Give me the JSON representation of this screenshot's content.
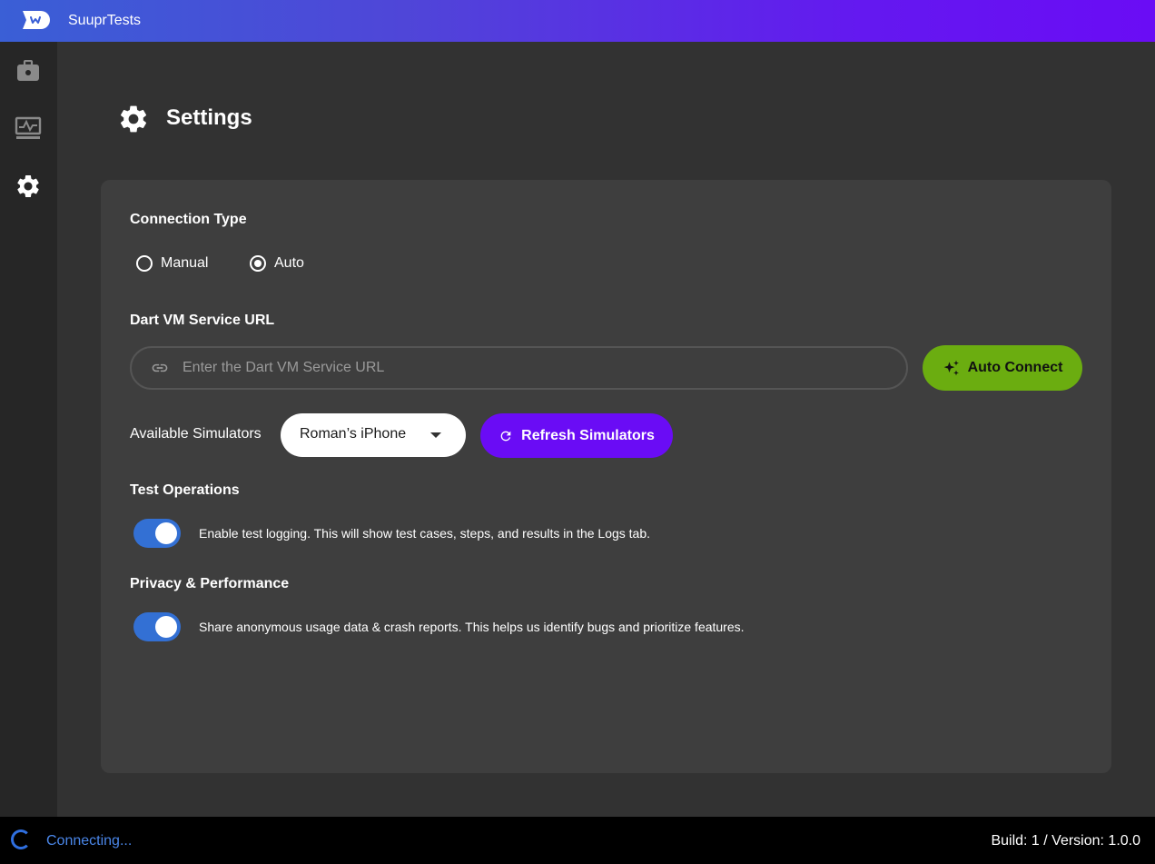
{
  "app": {
    "title": "SuuprTests"
  },
  "sidebar": {
    "items": [
      {
        "icon": "briefcase-icon",
        "active": false
      },
      {
        "icon": "monitor-activity-icon",
        "active": false
      },
      {
        "icon": "gear-icon",
        "active": true
      }
    ]
  },
  "page": {
    "title": "Settings",
    "icon": "gear-icon"
  },
  "connection": {
    "title": "Connection Type",
    "options": [
      {
        "label": "Manual",
        "selected": false
      },
      {
        "label": "Auto",
        "selected": true
      }
    ]
  },
  "dart_vm": {
    "title": "Dart VM Service URL",
    "placeholder": "Enter the Dart VM Service URL",
    "value": "",
    "auto_connect_label": "Auto Connect"
  },
  "simulators": {
    "label": "Available Simulators",
    "selected": "Roman’s iPhone",
    "refresh_label": "Refresh Simulators"
  },
  "test_operations": {
    "title": "Test Operations",
    "toggle_on": true,
    "description": "Enable test logging. This will show test cases, steps, and results in the Logs tab."
  },
  "privacy": {
    "title": "Privacy & Performance",
    "toggle_on": true,
    "description": "Share anonymous usage data & crash reports. This helps us identify bugs and prioritize features."
  },
  "status": {
    "connection": "Connecting...",
    "build": "Build: 1 / Version: 1.0.0"
  },
  "colors": {
    "accent_purple": "#6a0cf5",
    "accent_green": "#6bad10",
    "toggle_blue": "#3370d4",
    "status_blue": "#4a86e8"
  }
}
